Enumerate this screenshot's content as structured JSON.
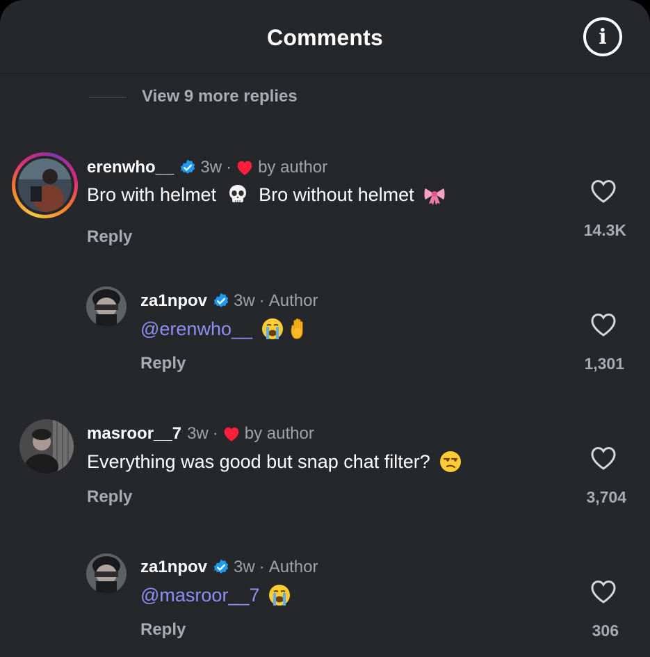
{
  "header": {
    "title": "Comments",
    "info_icon": "info-icon"
  },
  "thread": {
    "view_more_replies": "View 9 more replies"
  },
  "comments": [
    {
      "username": "erenwho__",
      "verified": true,
      "age": "3w",
      "separator": "·",
      "liked_by_author": "by author",
      "text": "Bro with helmet",
      "text2": "Bro without helmet",
      "emoji1": "skull-emoji",
      "emoji2": "ribbon-emoji",
      "reply_label": "Reply",
      "likes": "14.3K"
    },
    {
      "username": "za1npov",
      "verified": true,
      "age": "3w",
      "separator": "·",
      "author_badge": "Author",
      "mention": "@erenwho__",
      "emoji1": "loudly-crying-emoji",
      "emoji2": "raised-hand-emoji",
      "reply_label": "Reply",
      "likes": "1,301"
    },
    {
      "username": "masroor__7",
      "verified": false,
      "age": "3w",
      "separator": "·",
      "liked_by_author": "by author",
      "text": "Everything was good but snap chat filter?",
      "emoji1": "unamused-face-emoji",
      "reply_label": "Reply",
      "likes": "3,704"
    },
    {
      "username": "za1npov",
      "verified": true,
      "age": "3w",
      "separator": "·",
      "author_badge": "Author",
      "mention": "@masroor__7",
      "emoji1": "loudly-crying-emoji",
      "reply_label": "Reply",
      "likes": "306"
    }
  ],
  "colors": {
    "background": "#26272b",
    "text": "#ffffff",
    "muted": "#a0a3a9",
    "mention": "#8f8ff5",
    "verified": "#1d9bf0",
    "heart": "#ff1f3d"
  }
}
